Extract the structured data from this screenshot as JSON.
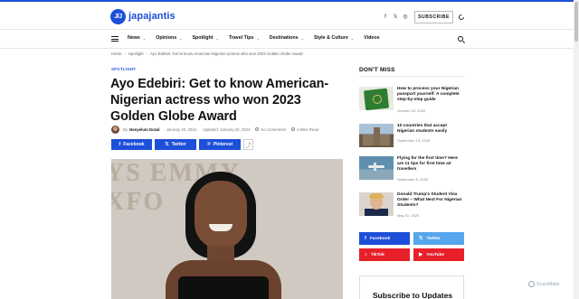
{
  "site": {
    "logo_mark": "J/J",
    "name": "japajantis",
    "tagline": "",
    "subscribe_label": "SUBSCRIBE",
    "social_icons": [
      "f",
      "𝕏",
      "◎",
      "♪"
    ],
    "accent_color": "#1d4fd8"
  },
  "nav": {
    "items": [
      {
        "label": "News",
        "has_dropdown": true
      },
      {
        "label": "Opinions",
        "has_dropdown": true
      },
      {
        "label": "Spotlight",
        "has_dropdown": true
      },
      {
        "label": "Travel Tips",
        "has_dropdown": true
      },
      {
        "label": "Destinations",
        "has_dropdown": true
      },
      {
        "label": "Style & Culture",
        "has_dropdown": true
      },
      {
        "label": "Videos",
        "has_dropdown": false
      }
    ]
  },
  "breadcrumb": [
    "Home",
    "Spotlight",
    "Ayo Edebiri: Get to know American-Nigerian actress who won 2023 Golden Globe Award"
  ],
  "article": {
    "category": "SPOTLIGHT",
    "title": "Ayo Edebiri: Get to know American-Nigerian actress who won 2023 Golden Globe Award",
    "by": "By",
    "author": "Nonyelum Dozal",
    "date": "January 20, 2024",
    "updated": "Updated: January 20, 2024",
    "comments": "No Comments",
    "read_time": "4 Mins Read",
    "share": [
      {
        "label": "Facebook",
        "icon": "f"
      },
      {
        "label": "Twitter",
        "icon": "𝕏"
      },
      {
        "label": "Pinterest",
        "icon": "℗"
      }
    ],
    "share_more": "⤴",
    "hero_bg_text": "YS EMMY\nXFO"
  },
  "sidebar": {
    "heading": "DON'T MISS",
    "posts": [
      {
        "title": "How to process your Nigerian passport yourself: A complete step-by-step guide",
        "date": "October 16, 2025",
        "thumb": "passport"
      },
      {
        "title": "10 countries that accept Nigerian students easily",
        "date": "September 13, 2025",
        "thumb": "city"
      },
      {
        "title": "Flying for the first time? Here are 11 tips for first time air travellers",
        "date": "September 8, 2025",
        "thumb": "plane"
      },
      {
        "title": "Donald Trump's Student Visa Order – What Next For Nigerian Students?",
        "date": "May 31, 2025",
        "thumb": "trump"
      }
    ],
    "social": [
      {
        "label": "Facebook",
        "icon": "f",
        "color": "#1d4fd8"
      },
      {
        "label": "Twitter",
        "icon": "𝕏",
        "color": "#55a6ec"
      },
      {
        "label": "TikTok",
        "icon": "♪",
        "color": "#e8202a"
      },
      {
        "label": "YouTube",
        "icon": "▶",
        "color": "#e8202a"
      }
    ],
    "subscribe_heading": "Subscribe to Updates"
  },
  "watermark": "ScanMatic"
}
